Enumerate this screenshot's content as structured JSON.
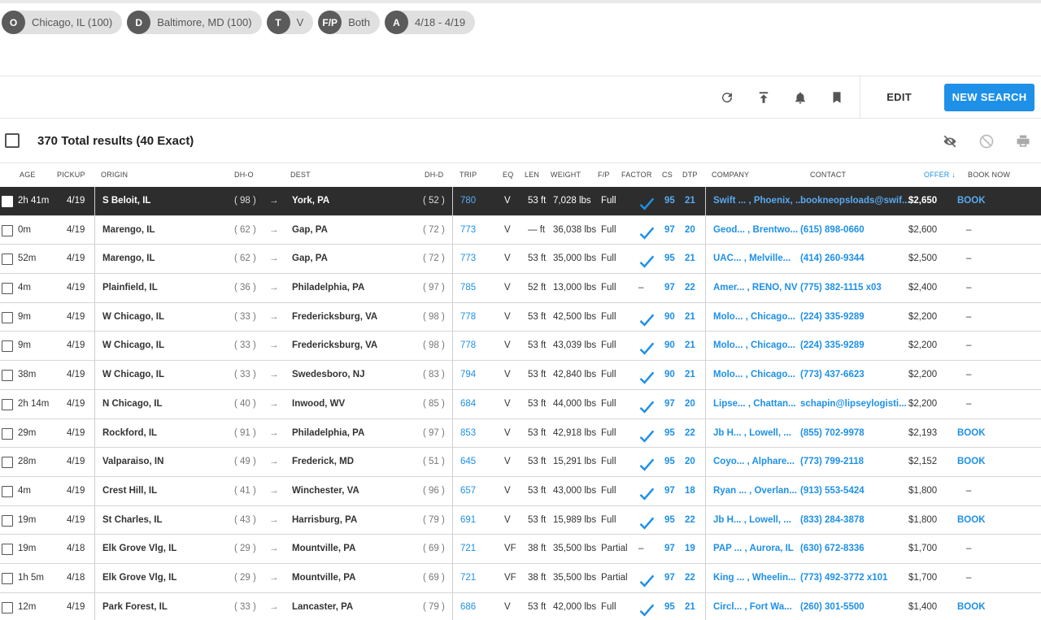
{
  "filters": [
    {
      "badge": "O",
      "text": "Chicago, IL (100)"
    },
    {
      "badge": "D",
      "text": "Baltimore, MD (100)"
    },
    {
      "badge": "T",
      "text": "V"
    },
    {
      "badge": "F/P",
      "text": "Both"
    },
    {
      "badge": "A",
      "text": "4/18 - 4/19"
    }
  ],
  "toolbar": {
    "edit_label": "EDIT",
    "new_search_label": "NEW SEARCH"
  },
  "results": {
    "summary": "370 Total results (40 Exact)"
  },
  "columns": {
    "age": "AGE",
    "pickup": "PICKUP",
    "origin": "ORIGIN",
    "dho": "DH-O",
    "dest": "DEST",
    "dhd": "DH-D",
    "trip": "TRIP",
    "eq": "EQ",
    "len": "LEN",
    "weight": "WEIGHT",
    "fp": "F/P",
    "factor": "FACTOR",
    "cs": "CS",
    "dtp": "DTP",
    "company": "COMPANY",
    "contact": "CONTACT",
    "offer": "OFFER ↓",
    "book": "BOOK NOW"
  },
  "colors": {
    "accent": "#1e90e8",
    "selected_row": "#2d2d2d"
  },
  "rows": [
    {
      "age": "2h 41m",
      "pickup": "4/19",
      "origin": "S Beloit, IL",
      "dho": "( 98 )",
      "dest": "York, PA",
      "dhd": "( 52 )",
      "trip": "780",
      "eq": "V",
      "len": "53 ft",
      "weight": "7,028 lbs",
      "fp": "Full",
      "factor": "check",
      "cs": "95",
      "dtp": "21",
      "company": "Swift ... , Phoenix, ...",
      "contact": "bookneopsloads@swif...",
      "offer": "$2,650",
      "book": "BOOK"
    },
    {
      "age": "0m",
      "pickup": "4/19",
      "origin": "Marengo, IL",
      "dho": "( 62 )",
      "dest": "Gap, PA",
      "dhd": "( 72 )",
      "trip": "773",
      "eq": "V",
      "len": "— ft",
      "weight": "36,038 lbs",
      "fp": "Full",
      "factor": "check",
      "cs": "97",
      "dtp": "20",
      "company": "Geod... , Brentwo...",
      "contact": "(615) 898-0660",
      "offer": "$2,600",
      "book": "–"
    },
    {
      "age": "52m",
      "pickup": "4/19",
      "origin": "Marengo, IL",
      "dho": "( 62 )",
      "dest": "Gap, PA",
      "dhd": "( 72 )",
      "trip": "773",
      "eq": "V",
      "len": "53 ft",
      "weight": "35,000 lbs",
      "fp": "Full",
      "factor": "check",
      "cs": "95",
      "dtp": "21",
      "company": "UAC... , Melville...",
      "contact": "(414) 260-9344",
      "offer": "$2,500",
      "book": "–"
    },
    {
      "age": "4m",
      "pickup": "4/19",
      "origin": "Plainfield, IL",
      "dho": "( 36 )",
      "dest": "Philadelphia, PA",
      "dhd": "( 97 )",
      "trip": "785",
      "eq": "V",
      "len": "52 ft",
      "weight": "13,000 lbs",
      "fp": "Full",
      "factor": "–",
      "cs": "97",
      "dtp": "22",
      "company": "Amer... , RENO, NV",
      "contact": "(775) 382-1115 x03",
      "offer": "$2,400",
      "book": "–"
    },
    {
      "age": "9m",
      "pickup": "4/19",
      "origin": "W Chicago, IL",
      "dho": "( 33 )",
      "dest": "Fredericksburg, VA",
      "dhd": "( 98 )",
      "trip": "778",
      "eq": "V",
      "len": "53 ft",
      "weight": "42,500 lbs",
      "fp": "Full",
      "factor": "check",
      "cs": "90",
      "dtp": "21",
      "company": "Molo... , Chicago...",
      "contact": "(224) 335-9289",
      "offer": "$2,200",
      "book": "–"
    },
    {
      "age": "9m",
      "pickup": "4/19",
      "origin": "W Chicago, IL",
      "dho": "( 33 )",
      "dest": "Fredericksburg, VA",
      "dhd": "( 98 )",
      "trip": "778",
      "eq": "V",
      "len": "53 ft",
      "weight": "43,039 lbs",
      "fp": "Full",
      "factor": "check",
      "cs": "90",
      "dtp": "21",
      "company": "Molo... , Chicago...",
      "contact": "(224) 335-9289",
      "offer": "$2,200",
      "book": "–"
    },
    {
      "age": "38m",
      "pickup": "4/19",
      "origin": "W Chicago, IL",
      "dho": "( 33 )",
      "dest": "Swedesboro, NJ",
      "dhd": "( 83 )",
      "trip": "794",
      "eq": "V",
      "len": "53 ft",
      "weight": "42,840 lbs",
      "fp": "Full",
      "factor": "check",
      "cs": "90",
      "dtp": "21",
      "company": "Molo... , Chicago...",
      "contact": "(773) 437-6623",
      "offer": "$2,200",
      "book": "–"
    },
    {
      "age": "2h 14m",
      "pickup": "4/19",
      "origin": "N Chicago, IL",
      "dho": "( 40 )",
      "dest": "Inwood, WV",
      "dhd": "( 85 )",
      "trip": "684",
      "eq": "V",
      "len": "53 ft",
      "weight": "44,000 lbs",
      "fp": "Full",
      "factor": "check",
      "cs": "97",
      "dtp": "20",
      "company": "Lipse... , Chattan...",
      "contact": "schapin@lipseylogisti...",
      "offer": "$2,200",
      "book": "–"
    },
    {
      "age": "29m",
      "pickup": "4/19",
      "origin": "Rockford, IL",
      "dho": "( 91 )",
      "dest": "Philadelphia, PA",
      "dhd": "( 97 )",
      "trip": "853",
      "eq": "V",
      "len": "53 ft",
      "weight": "42,918 lbs",
      "fp": "Full",
      "factor": "check",
      "cs": "95",
      "dtp": "22",
      "company": "Jb H... , Lowell, ...",
      "contact": "(855) 702-9978",
      "offer": "$2,193",
      "book": "BOOK"
    },
    {
      "age": "28m",
      "pickup": "4/19",
      "origin": "Valparaiso, IN",
      "dho": "( 49 )",
      "dest": "Frederick, MD",
      "dhd": "( 51 )",
      "trip": "645",
      "eq": "V",
      "len": "53 ft",
      "weight": "15,291 lbs",
      "fp": "Full",
      "factor": "check",
      "cs": "95",
      "dtp": "20",
      "company": "Coyo... , Alphare...",
      "contact": "(773) 799-2118",
      "offer": "$2,152",
      "book": "BOOK"
    },
    {
      "age": "4m",
      "pickup": "4/19",
      "origin": "Crest Hill, IL",
      "dho": "( 41 )",
      "dest": "Winchester, VA",
      "dhd": "( 96 )",
      "trip": "657",
      "eq": "V",
      "len": "53 ft",
      "weight": "43,000 lbs",
      "fp": "Full",
      "factor": "check",
      "cs": "97",
      "dtp": "18",
      "company": "Ryan ... , Overlan...",
      "contact": "(913) 553-5424",
      "offer": "$1,800",
      "book": "–"
    },
    {
      "age": "19m",
      "pickup": "4/19",
      "origin": "St Charles, IL",
      "dho": "( 43 )",
      "dest": "Harrisburg, PA",
      "dhd": "( 79 )",
      "trip": "691",
      "eq": "V",
      "len": "53 ft",
      "weight": "15,989 lbs",
      "fp": "Full",
      "factor": "check",
      "cs": "95",
      "dtp": "22",
      "company": "Jb H... , Lowell, ...",
      "contact": "(833) 284-3878",
      "offer": "$1,800",
      "book": "BOOK"
    },
    {
      "age": "19m",
      "pickup": "4/18",
      "origin": "Elk Grove Vlg, IL",
      "dho": "( 29 )",
      "dest": "Mountville, PA",
      "dhd": "( 69 )",
      "trip": "721",
      "eq": "VF",
      "len": "38 ft",
      "weight": "35,500 lbs",
      "fp": "Partial",
      "factor": "–",
      "cs": "97",
      "dtp": "19",
      "company": "PAP ... , Aurora, IL",
      "contact": "(630) 672-8336",
      "offer": "$1,700",
      "book": "–"
    },
    {
      "age": "1h 5m",
      "pickup": "4/18",
      "origin": "Elk Grove Vlg, IL",
      "dho": "( 29 )",
      "dest": "Mountville, PA",
      "dhd": "( 69 )",
      "trip": "721",
      "eq": "VF",
      "len": "38 ft",
      "weight": "35,500 lbs",
      "fp": "Partial",
      "factor": "check",
      "cs": "97",
      "dtp": "22",
      "company": "King ... , Wheelin...",
      "contact": "(773) 492-3772 x101",
      "offer": "$1,700",
      "book": "–"
    },
    {
      "age": "12m",
      "pickup": "4/19",
      "origin": "Park Forest, IL",
      "dho": "( 33 )",
      "dest": "Lancaster, PA",
      "dhd": "( 79 )",
      "trip": "686",
      "eq": "V",
      "len": "53 ft",
      "weight": "42,000 lbs",
      "fp": "Full",
      "factor": "check",
      "cs": "95",
      "dtp": "21",
      "company": "Circl... , Fort Wa...",
      "contact": "(260) 301-5500",
      "offer": "$1,400",
      "book": "BOOK"
    }
  ]
}
